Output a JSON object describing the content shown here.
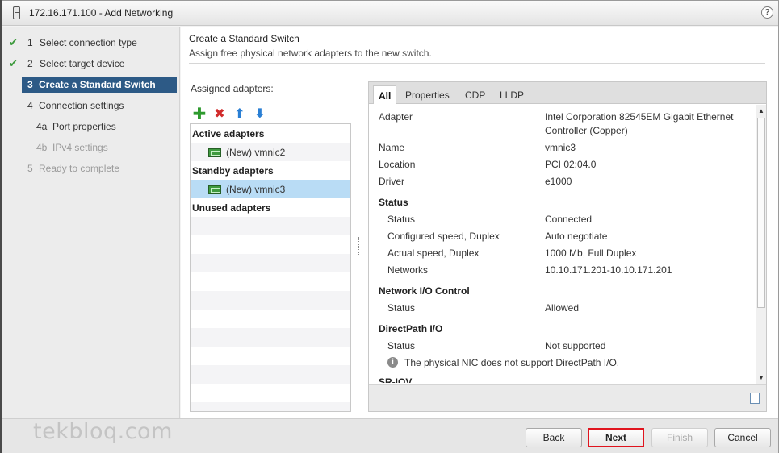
{
  "window": {
    "title": "172.16.171.100 - Add Networking",
    "help": "?"
  },
  "steps": [
    {
      "num": "1",
      "label": "Select connection type",
      "state": "done"
    },
    {
      "num": "2",
      "label": "Select target device",
      "state": "done"
    },
    {
      "num": "3",
      "label": "Create a Standard Switch",
      "state": "active"
    },
    {
      "num": "4",
      "label": "Connection settings",
      "state": "pending"
    },
    {
      "num": "4a",
      "label": "Port properties",
      "state": "pending"
    },
    {
      "num": "4b",
      "label": "IPv4 settings",
      "state": "disabled"
    },
    {
      "num": "5",
      "label": "Ready to complete",
      "state": "disabled"
    }
  ],
  "header": {
    "title": "Create a Standard Switch",
    "subtitle": "Assign free physical network adapters to the new switch."
  },
  "adapters": {
    "label": "Assigned adapters:",
    "groups": {
      "active": "Active adapters",
      "standby": "Standby adapters",
      "unused": "Unused adapters"
    },
    "active_item": "(New) vmnic2",
    "standby_item": "(New) vmnic3"
  },
  "tabs": [
    "All",
    "Properties",
    "CDP",
    "LLDP"
  ],
  "details": {
    "adapter_label": "Adapter",
    "adapter_value_1": "Intel Corporation 82545EM Gigabit Ethernet",
    "adapter_value_2": "Controller (Copper)",
    "name_label": "Name",
    "name_value": "vmnic3",
    "location_label": "Location",
    "location_value": "PCI 02:04.0",
    "driver_label": "Driver",
    "driver_value": "e1000",
    "status_section": "Status",
    "status_label": "Status",
    "status_value": "Connected",
    "conf_speed_label": "Configured speed, Duplex",
    "conf_speed_value": "Auto negotiate",
    "act_speed_label": "Actual speed, Duplex",
    "act_speed_value": "1000 Mb, Full Duplex",
    "networks_label": "Networks",
    "networks_value": "10.10.171.201-10.10.171.201",
    "nioc_section": "Network I/O Control",
    "nioc_status_label": "Status",
    "nioc_status_value": "Allowed",
    "dp_section": "DirectPath I/O",
    "dp_status_label": "Status",
    "dp_status_value": "Not supported",
    "dp_note": "The physical NIC does not support DirectPath I/O.",
    "sriov_section": "SR-IOV"
  },
  "footer": {
    "watermark": "tekbloq.com",
    "back": "Back",
    "next": "Next",
    "finish": "Finish",
    "cancel": "Cancel"
  }
}
